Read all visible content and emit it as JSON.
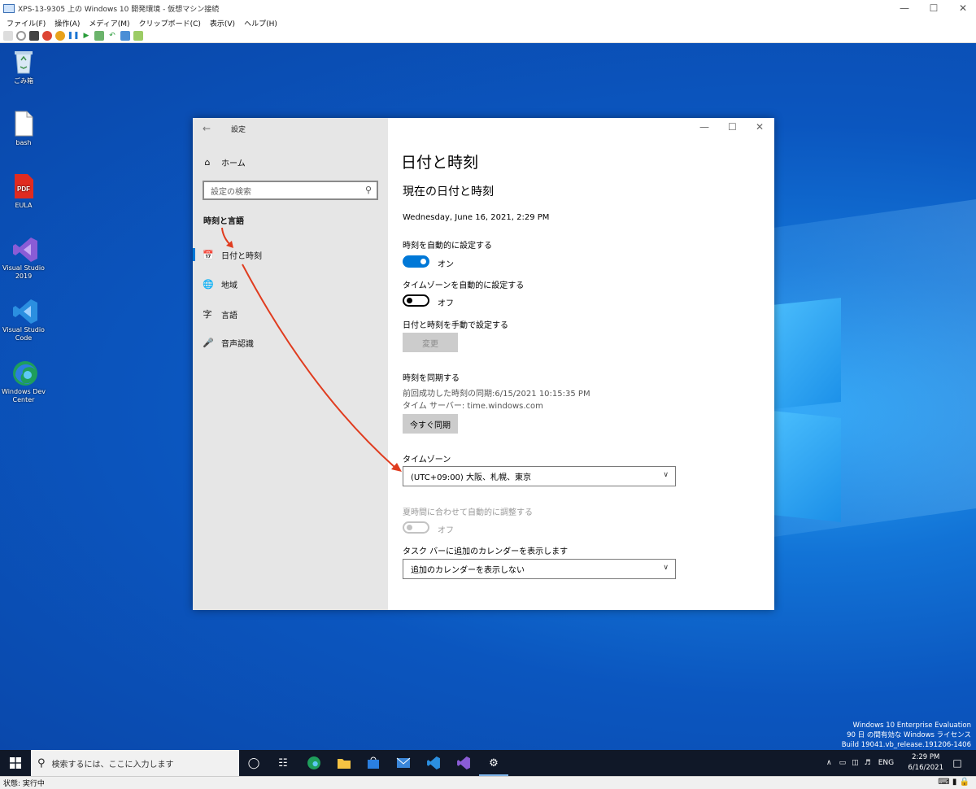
{
  "host": {
    "title": "XPS-13-9305 上の Windows 10 開発環境 - 仮想マシン接続",
    "menu": [
      "ファイル(F)",
      "操作(A)",
      "メディア(M)",
      "クリップボード(C)",
      "表示(V)",
      "ヘルプ(H)"
    ],
    "status": "状態: 実行中"
  },
  "desktop": {
    "icons": [
      {
        "label": "ごみ箱",
        "icon": "recycle-bin-icon"
      },
      {
        "label": "bash",
        "icon": "file-icon"
      },
      {
        "label": "EULA",
        "icon": "pdf-icon",
        "badge": "PDF"
      },
      {
        "label": "Visual Studio 2019",
        "icon": "visual-studio-icon"
      },
      {
        "label": "Visual Studio Code",
        "icon": "vscode-icon"
      },
      {
        "label": "Windows Dev Center",
        "icon": "edge-icon"
      }
    ],
    "watermark": [
      "Windows 10 Enterprise Evaluation",
      "90 日 の間有効な Windows ライセンス",
      "Build 19041.vb_release.191206-1406"
    ]
  },
  "settings": {
    "window_title": "設定",
    "sidebar": {
      "home": "ホーム",
      "search_placeholder": "設定の検索",
      "section": "時刻と言語",
      "items": [
        {
          "label": "日付と時刻",
          "icon": "calendar-clock-icon",
          "selected": true
        },
        {
          "label": "地域",
          "icon": "globe-icon"
        },
        {
          "label": "言語",
          "icon": "language-icon"
        },
        {
          "label": "音声認識",
          "icon": "microphone-icon"
        }
      ]
    },
    "main": {
      "title": "日付と時刻",
      "current_heading": "現在の日付と時刻",
      "current_datetime": "Wednesday, June 16, 2021, 2:29 PM",
      "auto_time_label": "時刻を自動的に設定する",
      "auto_time_state": "オン",
      "auto_tz_label": "タイムゾーンを自動的に設定する",
      "auto_tz_state": "オフ",
      "manual_label": "日付と時刻を手動で設定する",
      "change_button": "変更",
      "sync_heading": "時刻を同期する",
      "last_sync": "前回成功した時刻の同期:6/15/2021 10:15:35 PM",
      "time_server": "タイム サーバー: time.windows.com",
      "sync_button": "今すぐ同期",
      "timezone_label": "タイムゾーン",
      "timezone_value": "(UTC+09:00) 大阪、札幌、東京",
      "dst_label": "夏時間に合わせて自動的に調整する",
      "dst_state": "オフ",
      "calendar_label": "タスク バーに追加のカレンダーを表示します",
      "calendar_value": "追加のカレンダーを表示しない"
    }
  },
  "taskbar": {
    "search_placeholder": "検索するには、ここに入力します",
    "apps": [
      "cortana-icon",
      "task-view-icon",
      "edge-icon",
      "file-explorer-icon",
      "store-icon",
      "mail-icon",
      "vscode-icon",
      "visual-studio-icon",
      "settings-icon"
    ],
    "language": "ENG",
    "time": "2:29 PM",
    "date": "6/16/2021"
  },
  "colors": {
    "accent": "#0078d7",
    "annotation": "#e03c1f",
    "taskbar": "#101828"
  }
}
